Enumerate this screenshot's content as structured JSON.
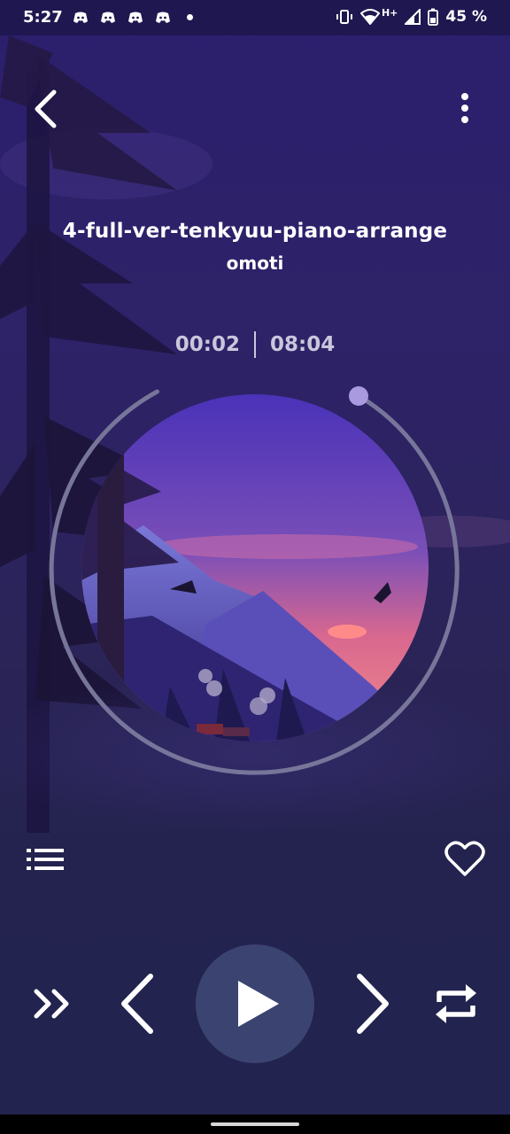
{
  "status_bar": {
    "time": "5:27",
    "battery_percent": "45 %",
    "network_type": "H+",
    "notification_icons": [
      "discord-icon",
      "discord-icon",
      "discord-icon",
      "discord-icon"
    ]
  },
  "track": {
    "title": "4-full-ver-tenkyuu-piano-arrange",
    "artist": "omoti",
    "elapsed": "00:02",
    "duration": "08:04",
    "progress_fraction": 0.004
  },
  "icons": {
    "back": "chevron-left-icon",
    "menu": "more-vertical-icon",
    "playlist": "playlist-icon",
    "favorite": "heart-outline-icon",
    "shuffle": "double-chevron-right-icon",
    "previous": "chevron-left-icon",
    "play": "play-icon",
    "next": "chevron-right-icon",
    "repeat": "repeat-icon"
  },
  "colors": {
    "background_top": "#2b1f6e",
    "background_bottom": "#22234f",
    "accent": "#a99ae0",
    "play_button": "#3b4470",
    "progress_track": "#6a6a86"
  }
}
